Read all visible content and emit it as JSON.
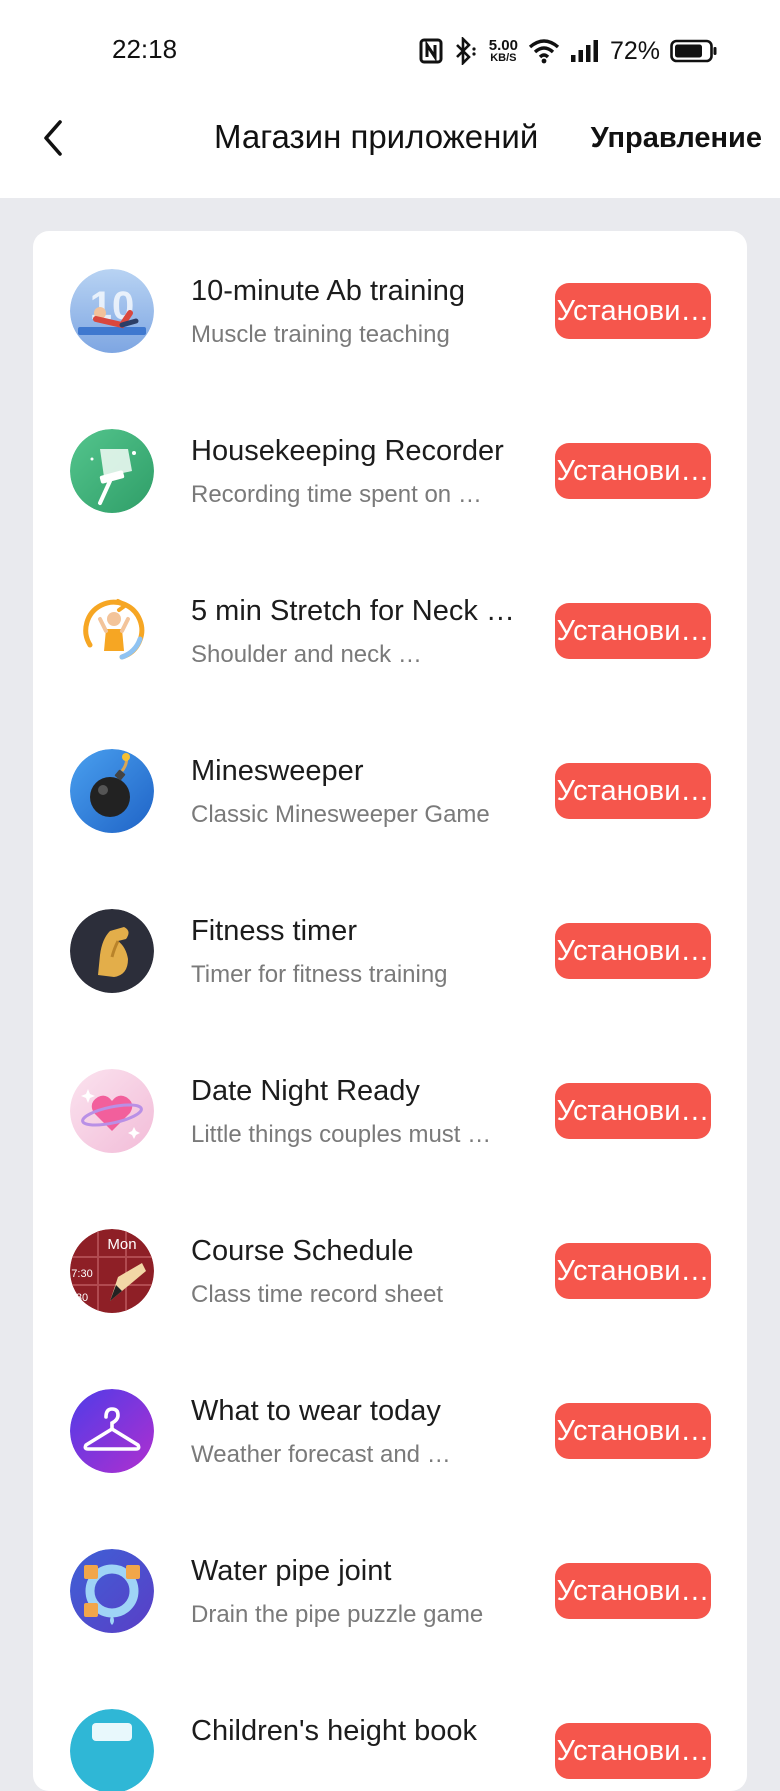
{
  "status_bar": {
    "time": "22:18",
    "nfc_icon": "nfc-icon",
    "bluetooth_icon": "bluetooth-icon",
    "speed_value": "5.00",
    "speed_unit": "KB/S",
    "wifi_icon": "wifi-icon",
    "signal_icon": "signal-icon",
    "battery": "72%",
    "battery_icon": "battery-icon"
  },
  "header": {
    "back_icon": "chevron-left-icon",
    "title": "Магазин приложений",
    "manage_label": "Управление"
  },
  "apps": [
    {
      "name": "10-minute Ab training",
      "desc": "Muscle training teaching",
      "button": "Установи…",
      "icon": "ab-training-icon"
    },
    {
      "name": "Housekeeping Recorder",
      "desc": "Recording time spent on …",
      "button": "Установи…",
      "icon": "mop-icon"
    },
    {
      "name": "5 min Stretch for Neck …",
      "desc": "Shoulder and neck …",
      "button": "Установи…",
      "icon": "stretch-icon"
    },
    {
      "name": "Minesweeper",
      "desc": "Classic Minesweeper Game",
      "button": "Установи…",
      "icon": "bomb-icon"
    },
    {
      "name": "Fitness timer",
      "desc": "Timer for fitness training",
      "button": "Установи…",
      "icon": "muscle-arm-icon"
    },
    {
      "name": "Date Night Ready",
      "desc": "Little things couples must …",
      "button": "Установи…",
      "icon": "heart-planet-icon"
    },
    {
      "name": "Course Schedule",
      "desc": "Class time record sheet",
      "button": "Установи…",
      "icon": "calendar-pencil-icon",
      "icon_texts": [
        "Mon",
        "7:30",
        "30"
      ]
    },
    {
      "name": "What to wear today",
      "desc": "Weather forecast and …",
      "button": "Установи…",
      "icon": "hanger-icon"
    },
    {
      "name": "Water pipe joint",
      "desc": "Drain the pipe puzzle game",
      "button": "Установи…",
      "icon": "pipe-ring-icon"
    },
    {
      "name": "Children's height book",
      "desc": "",
      "button": "Установи…",
      "icon": "height-book-icon"
    }
  ],
  "colors": {
    "install_button": "#f5564c",
    "page_background": "#e9eaee",
    "card_background": "#ffffff"
  }
}
